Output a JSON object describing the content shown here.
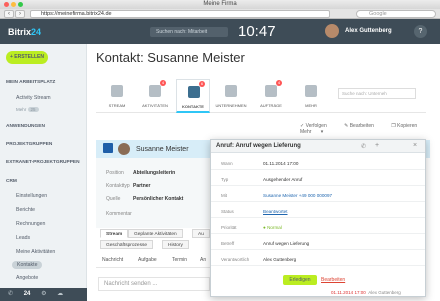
{
  "browser": {
    "window_title": "Meine Firma",
    "url": "https://meinefirma.bitrix24.de",
    "search_placeholder": "Google"
  },
  "topbar": {
    "logo_a": "Bitrix",
    "logo_b": "24",
    "search_placeholder": "Suchen nach: Mitarbeit",
    "clock": "10:47",
    "username": "Alex Guttenberg",
    "help": "?"
  },
  "sidebar": {
    "create_label": "+ ERSTELLEN",
    "sections": {
      "workspace": "MEIN ARBEITSPLATZ",
      "apps": "ANWENDUNGEN",
      "projects": "PROJEKTGRUPPEN",
      "extranet": "EXTRANET-PROJEKTGRUPPEN",
      "crm": "CRM"
    },
    "activity_stream": "Activity Stream",
    "more_label": "Mehr",
    "more_count": "25",
    "crm_items": [
      "Einstellungen",
      "Berichte",
      "Rechnungen",
      "Leads",
      "Meine Aktivitäten",
      "Kontakte",
      "Angebote"
    ],
    "bottom_label": "24"
  },
  "main": {
    "title": "Kontakt: Susanne Meister",
    "tabs": [
      {
        "label": "STREAM",
        "badge": ""
      },
      {
        "label": "AKTIVITÄTEN",
        "badge": "4"
      },
      {
        "label": "KONTAKTE",
        "badge": "6"
      },
      {
        "label": "UNTERNEHMEN",
        "badge": ""
      },
      {
        "label": "AUFTRÄGE",
        "badge": "4"
      },
      {
        "label": "MEHR",
        "badge": ""
      }
    ],
    "tab_search_placeholder": "Suche nach: Unterneh",
    "actions": [
      "Verfolgen",
      "Bearbeiten",
      "Kopieren",
      "Mehr"
    ],
    "card_name": "Susanne Meister",
    "details": [
      {
        "label": "Position",
        "value": "Abteilungsleiterin"
      },
      {
        "label": "Kontakttyp",
        "value": "Partner"
      },
      {
        "label": "Quelle",
        "value": "Persönlicher Kontakt"
      },
      {
        "label": "Kommentar",
        "value": ""
      }
    ],
    "stream_tabs": [
      "Stream",
      "Geplante Aktivitäten",
      "Au"
    ],
    "stream_tabs2": [
      "Geschäftsprozesse",
      "History"
    ],
    "subtabs": [
      "Nachricht",
      "Aufgabe",
      "Termin",
      "An"
    ],
    "nachricht_placeholder": "Nachricht senden ..."
  },
  "popup": {
    "title": "Anruf: Anruf wegen Lieferung",
    "rows": [
      {
        "label": "Wann",
        "value": "01.11.2014 17:00"
      },
      {
        "label": "Typ",
        "value": "Ausgehender Anruf"
      },
      {
        "label": "Mit",
        "value": "Susanne Meister +49 000 000097"
      },
      {
        "label": "Status",
        "value": "Beantwortet"
      },
      {
        "label": "Priorität",
        "value": "Normal"
      },
      {
        "label": "Betreff",
        "value": "Anruf wegen Lieferung"
      },
      {
        "label": "Verantwortlich",
        "value": "Alex Guttenberg"
      }
    ],
    "ok_label": "Erledigen",
    "delete_label": "Bearbeiten",
    "footer_time": "01.11.2014 17:00",
    "footer_user": "Alex Guttenberg"
  }
}
